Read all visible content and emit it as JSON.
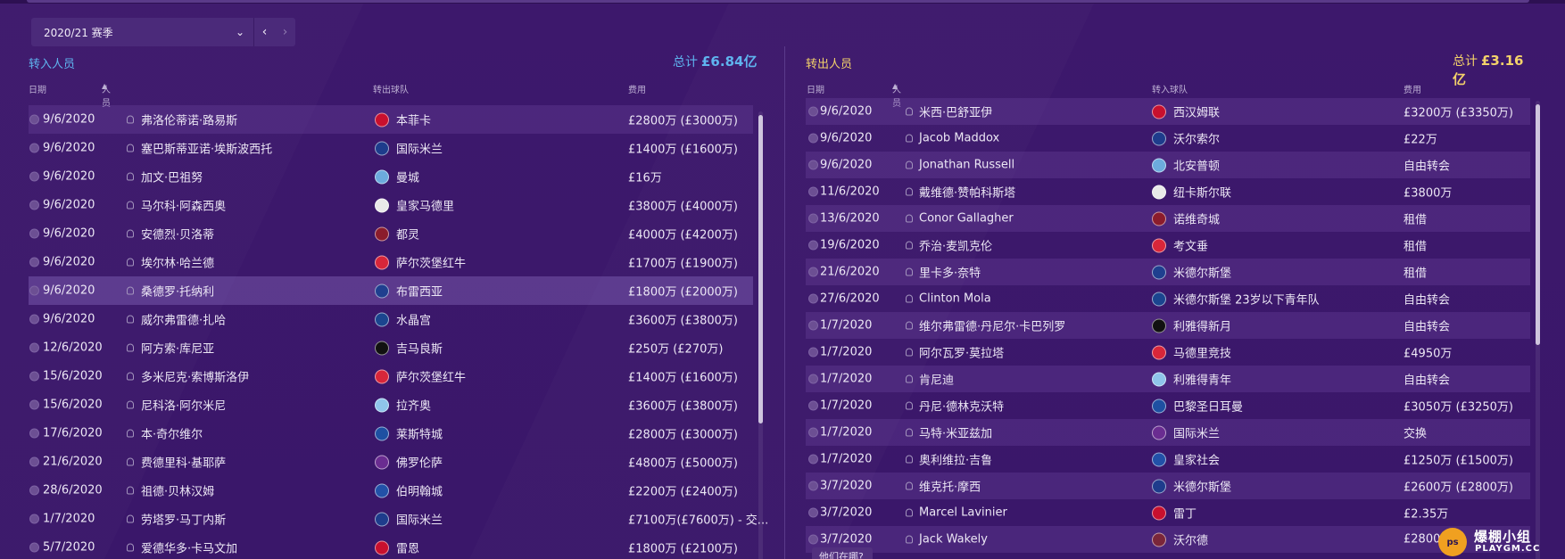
{
  "season": {
    "label": "2020/21 赛季"
  },
  "incoming": {
    "title": "转入人员",
    "total_label": "总计",
    "total_value": "£6.84亿",
    "columns": {
      "date": "日期",
      "person": "人员",
      "club": "转出球队",
      "fee": "费用"
    },
    "rows": [
      {
        "date": "9/6/2020",
        "name": "弗洛伦蒂诺·路易斯",
        "club": "本菲卡",
        "fee": "£2800万 (£3000万)"
      },
      {
        "date": "9/6/2020",
        "name": "塞巴斯蒂亚诺·埃斯波西托",
        "club": "国际米兰",
        "fee": "£1400万 (£1600万)"
      },
      {
        "date": "9/6/2020",
        "name": "加文·巴祖努",
        "club": "曼城",
        "fee": "£16万"
      },
      {
        "date": "9/6/2020",
        "name": "马尔科·阿森西奥",
        "club": "皇家马德里",
        "fee": "£3800万 (£4000万)"
      },
      {
        "date": "9/6/2020",
        "name": "安德烈·贝洛蒂",
        "club": "都灵",
        "fee": "£4000万 (£4200万)"
      },
      {
        "date": "9/6/2020",
        "name": "埃尔林·哈兰德",
        "club": "萨尔茨堡红牛",
        "fee": "£1700万 (£1900万)"
      },
      {
        "date": "9/6/2020",
        "name": "桑德罗·托纳利",
        "club": "布雷西亚",
        "fee": "£1800万 (£2000万)"
      },
      {
        "date": "9/6/2020",
        "name": "威尔弗雷德·扎哈",
        "club": "水晶宫",
        "fee": "£3600万 (£3800万)"
      },
      {
        "date": "12/6/2020",
        "name": "阿方索·库尼亚",
        "club": "吉马良斯",
        "fee": "£250万 (£270万)"
      },
      {
        "date": "15/6/2020",
        "name": "多米尼克·索博斯洛伊",
        "club": "萨尔茨堡红牛",
        "fee": "£1400万 (£1600万)"
      },
      {
        "date": "15/6/2020",
        "name": "尼科洛·阿尔米尼",
        "club": "拉齐奥",
        "fee": "£3600万 (£3800万)"
      },
      {
        "date": "17/6/2020",
        "name": "本·奇尔维尔",
        "club": "莱斯特城",
        "fee": "£2800万 (£3000万)"
      },
      {
        "date": "21/6/2020",
        "name": "费德里科·基耶萨",
        "club": "佛罗伦萨",
        "fee": "£4800万 (£5000万)"
      },
      {
        "date": "28/6/2020",
        "name": "祖德·贝林汉姆",
        "club": "伯明翰城",
        "fee": "£2200万 (£2400万)"
      },
      {
        "date": "1/7/2020",
        "name": "劳塔罗·马丁内斯",
        "club": "国际米兰",
        "fee": "£7100万(£7600万) - 交..."
      },
      {
        "date": "5/7/2020",
        "name": "爱德华多·卡马文加",
        "club": "雷恩",
        "fee": "£1800万 (£2100万)"
      }
    ]
  },
  "outgoing": {
    "title": "转出人员",
    "total_label": "总计",
    "total_value": "£3.16亿",
    "columns": {
      "date": "日期",
      "person": "人员",
      "club": "转入球队",
      "fee": "费用"
    },
    "rows": [
      {
        "date": "9/6/2020",
        "name": "米西·巴舒亚伊",
        "club": "西汉姆联",
        "fee": "£3200万 (£3350万)"
      },
      {
        "date": "9/6/2020",
        "name": "Jacob Maddox",
        "club": "沃尔索尔",
        "fee": "£22万"
      },
      {
        "date": "9/6/2020",
        "name": "Jonathan Russell",
        "club": "北安普顿",
        "fee": "自由转会"
      },
      {
        "date": "11/6/2020",
        "name": "戴维德·赞帕科斯塔",
        "club": "纽卡斯尔联",
        "fee": "£3800万"
      },
      {
        "date": "13/6/2020",
        "name": "Conor Gallagher",
        "club": "诺维奇城",
        "fee": "租借"
      },
      {
        "date": "19/6/2020",
        "name": "乔治·麦凯克伦",
        "club": "考文垂",
        "fee": "租借"
      },
      {
        "date": "21/6/2020",
        "name": "里卡多·奈特",
        "club": "米德尔斯堡",
        "fee": "租借"
      },
      {
        "date": "27/6/2020",
        "name": "Clinton Mola",
        "club": "米德尔斯堡 23岁以下青年队",
        "fee": "自由转会"
      },
      {
        "date": "1/7/2020",
        "name": "维尔弗雷德·丹尼尔·卡巴列罗",
        "club": "利雅得新月",
        "fee": "自由转会"
      },
      {
        "date": "1/7/2020",
        "name": "阿尔瓦罗·莫拉塔",
        "club": "马德里竞技",
        "fee": "£4950万"
      },
      {
        "date": "1/7/2020",
        "name": "肯尼迪",
        "club": "利雅得青年",
        "fee": "自由转会"
      },
      {
        "date": "1/7/2020",
        "name": "丹尼·德林克沃特",
        "club": "巴黎圣日耳曼",
        "fee": "£3050万 (£3250万)"
      },
      {
        "date": "1/7/2020",
        "name": "马特·米亚兹加",
        "club": "国际米兰",
        "fee": "交换"
      },
      {
        "date": "1/7/2020",
        "name": "奥利维拉·吉鲁",
        "club": "皇家社会",
        "fee": "£1250万 (£1500万)"
      },
      {
        "date": "3/7/2020",
        "name": "维克托·摩西",
        "club": "米德尔斯堡",
        "fee": "£2600万 (£2800万)"
      },
      {
        "date": "3/7/2020",
        "name": "Marcel Lavinier",
        "club": "雷丁",
        "fee": "£2.35万"
      },
      {
        "date": "3/7/2020",
        "name": "Jack Wakely",
        "club": "沃尔德",
        "fee": "£2800"
      }
    ]
  },
  "tooltip": {
    "text": "他们在哪?"
  },
  "watermark": {
    "badge": "ps",
    "line1": "爆棚小组",
    "line2": "PLAYGM.CC"
  },
  "colors": {
    "incoming_accent": "#5fb4ef",
    "outgoing_accent": "#f4d26a",
    "background": "#3b1768"
  }
}
